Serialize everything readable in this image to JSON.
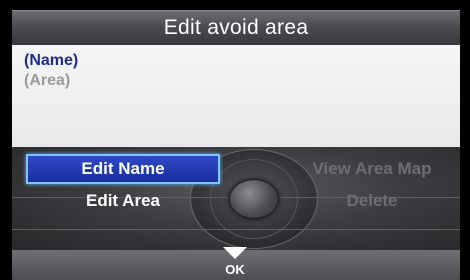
{
  "title": "Edit avoid area",
  "info": {
    "name": "(Name)",
    "area": "(Area)"
  },
  "menu": {
    "edit_name": "Edit Name",
    "edit_area": "Edit Area",
    "view_area_map": "View Area Map",
    "delete": "Delete",
    "selected": "Edit Name"
  },
  "footer": {
    "ok_label": "OK"
  },
  "colors": {
    "highlight": "#1a2e9c",
    "highlight_border": "#7fc4ff",
    "name_text": "#1f2d8a",
    "disabled_text": "#6c6e72"
  }
}
